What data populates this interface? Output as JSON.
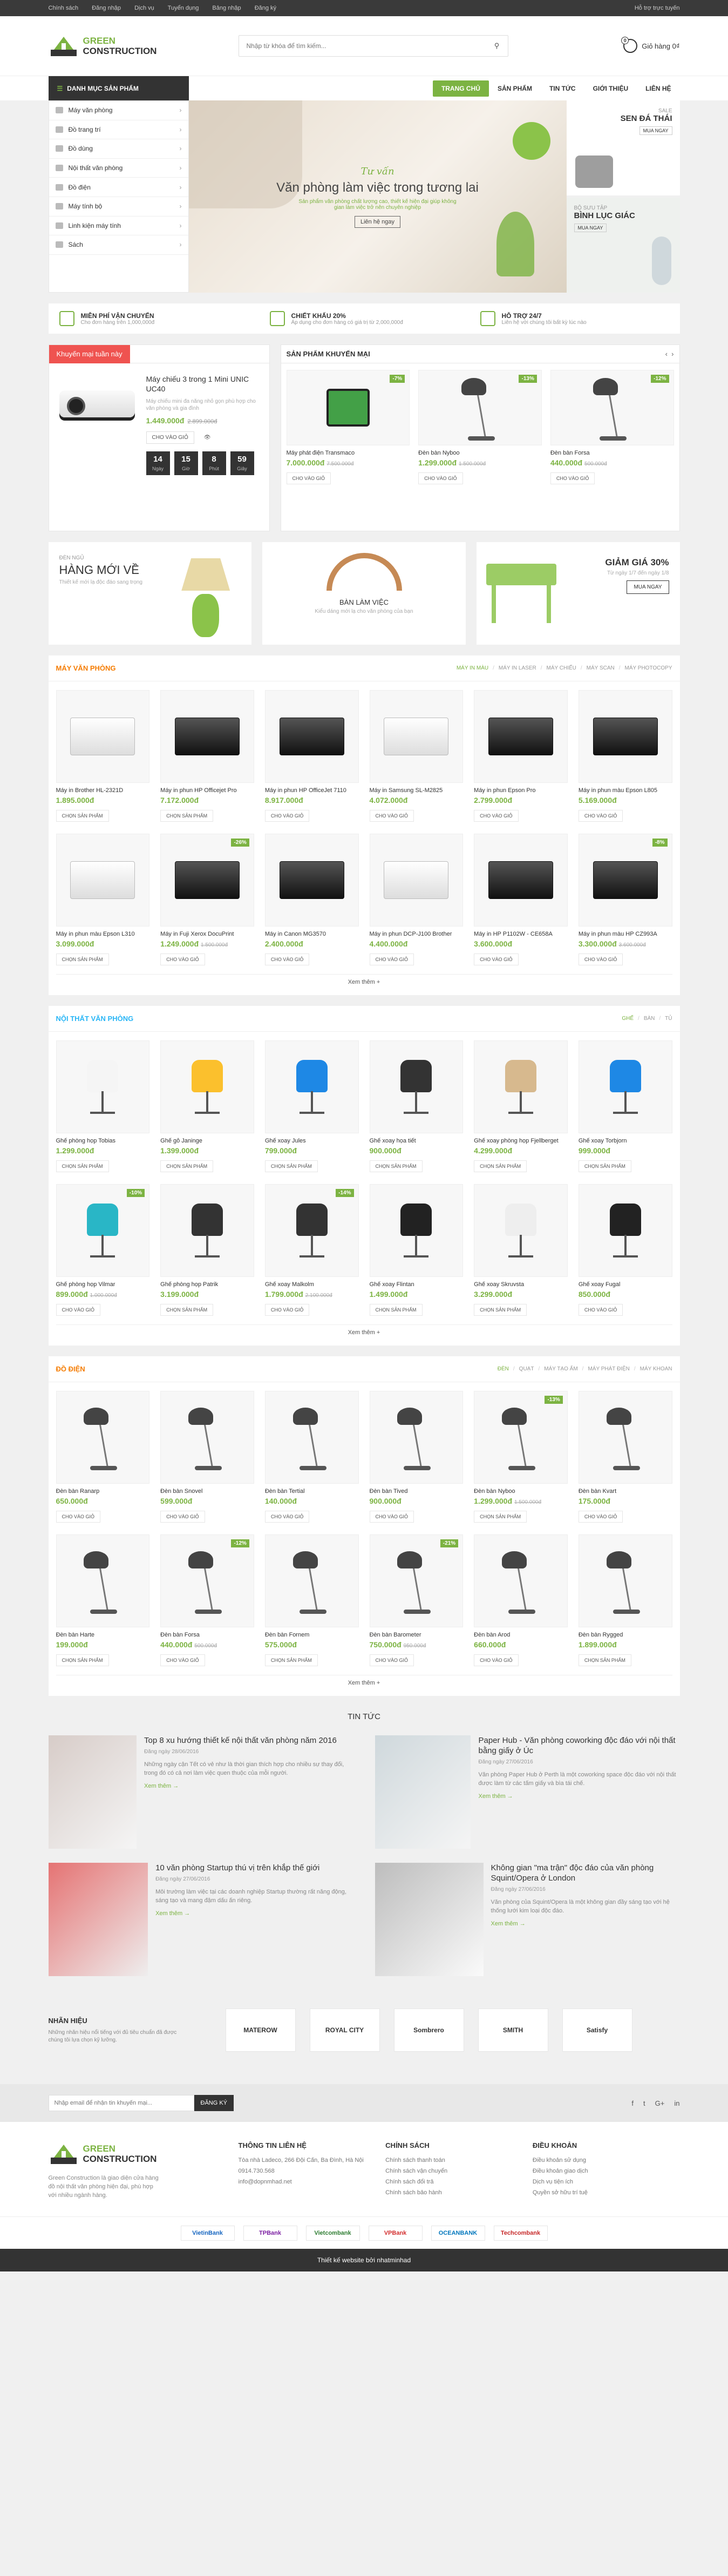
{
  "topbar": {
    "links": [
      "Chính sách",
      "Đăng nhập",
      "Dịch vụ",
      "Tuyển dụng",
      "Bảng nhập",
      "Đăng ký"
    ],
    "right": "Hỗ trợ trực tuyến"
  },
  "header": {
    "brand1": "GREEN",
    "brand2": "CONSTRUCTION",
    "search_placeholder": "Nhập từ khóa để tìm kiếm...",
    "cart_count": "0",
    "cart_label": "Giỏ hàng 0₫"
  },
  "nav": {
    "cat_label": "DANH MỤC SẢN PHẨM",
    "menu": [
      "TRANG CHỦ",
      "SẢN PHẨM",
      "TIN TỨC",
      "GIỚI THIỆU",
      "LIÊN HỆ"
    ]
  },
  "sidebar": [
    "Máy văn phòng",
    "Đồ trang trí",
    "Đồ dùng",
    "Nội thất văn phòng",
    "Đồ điện",
    "Máy tính bộ",
    "Linh kiện máy tính",
    "Sách"
  ],
  "slider": {
    "small": "Tư vấn",
    "big": "Văn phòng làm việc trong tương lai",
    "desc": "Sản phẩm văn phòng chất lượng cao, thiết kế hiện đại giúp không gian làm việc trở nên chuyên nghiệp",
    "btn": "Liên hệ ngay"
  },
  "side_banners": [
    {
      "s": "SALE",
      "t": "SEN ĐÁ THÁI",
      "b": "MUA NGAY"
    },
    {
      "s": "BỘ SƯU TẬP",
      "t": "BÌNH LỤC GIÁC",
      "b": "MUA NGAY"
    }
  ],
  "policy": [
    {
      "t": "MIỄN PHÍ VẬN CHUYỂN",
      "d": "Cho đơn hàng trên 1,000,000đ"
    },
    {
      "t": "CHIẾT KHẤU 20%",
      "d": "Áp dụng cho đơn hàng có giá trị từ 2,000,000đ"
    },
    {
      "t": "HỖ TRỢ 24/7",
      "d": "Liên hệ với chúng tôi bất kỳ lúc nào"
    }
  ],
  "deal": {
    "title": "Khuyến mại tuần này",
    "name": "Máy chiếu 3 trong 1 Mini UNIC UC40",
    "desc": "Máy chiếu mini đa năng nhỏ gọn phù hợp cho văn phòng và gia đình",
    "price": "1.449.000đ",
    "old": "2.899.000đ",
    "cart": "CHO VÀO GIỎ",
    "timer": [
      {
        "v": "14",
        "l": "Ngày"
      },
      {
        "v": "15",
        "l": "Giờ"
      },
      {
        "v": "8",
        "l": "Phút"
      },
      {
        "v": "59",
        "l": "Giây"
      }
    ]
  },
  "promo": {
    "title": "SẢN PHẨM KHUYẾN MẠI",
    "items": [
      {
        "n": "Máy phát điện Transmaco",
        "p": "7.000.000đ",
        "o": "7.500.000đ",
        "b": "-7%"
      },
      {
        "n": "Đèn bàn Nyboo",
        "p": "1.299.000đ",
        "o": "1.500.000đ",
        "b": "-13%"
      },
      {
        "n": "Đèn bàn Forsa",
        "p": "440.000đ",
        "o": "500.000đ",
        "b": "-12%"
      }
    ],
    "cart": "CHO VÀO GIỎ"
  },
  "three": [
    {
      "s": "ĐÈN NGỦ",
      "t": "HÀNG MỚI VỀ",
      "d": "Thiết kế mới lạ độc đáo sang trọng"
    },
    {
      "t": "BÀN LÀM VIỆC",
      "d": "Kiểu dáng mới lạ cho văn phòng của bạn"
    },
    {
      "t": "GIẢM GIÁ 30%",
      "d": "Từ ngày 1/7 đến ngày 1/8",
      "b": "MUA NGAY"
    }
  ],
  "sec_may": {
    "title": "MÁY VĂN PHÒNG",
    "tabs": [
      "MÁY IN MÀU",
      "MÁY IN LASER",
      "MÁY CHIẾU",
      "MÁY SCAN",
      "MÁY PHOTOCOPY"
    ],
    "btn": "CHỌN SẢN PHẨM",
    "cart": "CHO VÀO GIỎ",
    "more": "Xem thêm +",
    "items": [
      {
        "n": "Máy in Brother HL-2321D",
        "p": "1.895.000đ",
        "o": "",
        "b": ""
      },
      {
        "n": "Máy in phun HP Officejet Pro",
        "p": "7.172.000đ",
        "o": "",
        "b": ""
      },
      {
        "n": "Máy in phun HP OfficeJet 7110",
        "p": "8.917.000đ",
        "o": "",
        "b": ""
      },
      {
        "n": "Máy in Samsung SL-M2825",
        "p": "4.072.000đ",
        "o": "",
        "b": ""
      },
      {
        "n": "Máy in phun Epson Pro",
        "p": "2.799.000đ",
        "o": "",
        "b": ""
      },
      {
        "n": "Máy in phun màu Epson L805",
        "p": "5.169.000đ",
        "o": "",
        "b": ""
      },
      {
        "n": "Máy in phun màu Epson L310",
        "p": "3.099.000đ",
        "o": "",
        "b": ""
      },
      {
        "n": "Máy in Fuji Xerox DocuPrint",
        "p": "1.249.000đ",
        "o": "1.500.000đ",
        "b": "-26%"
      },
      {
        "n": "Máy in Canon MG3570",
        "p": "2.400.000đ",
        "o": "",
        "b": ""
      },
      {
        "n": "Máy in phun DCP-J100 Brother",
        "p": "4.400.000đ",
        "o": "",
        "b": ""
      },
      {
        "n": "Máy in HP P1102W - CE658A",
        "p": "3.600.000đ",
        "o": "",
        "b": ""
      },
      {
        "n": "Máy in phun màu HP CZ993A",
        "p": "3.300.000đ",
        "o": "3.600.000đ",
        "b": "-8%"
      }
    ]
  },
  "sec_noi": {
    "title": "NỘI THẤT VĂN PHÒNG",
    "tabs": [
      "GHẾ",
      "BÀN",
      "TỦ"
    ],
    "btn": "CHỌN SẢN PHẨM",
    "cart": "CHO VÀO GIỎ",
    "more": "Xem thêm +",
    "items": [
      {
        "n": "Ghế phòng họp Tobias",
        "p": "1.299.000đ",
        "o": "",
        "b": "",
        "c": "#f5f5f5"
      },
      {
        "n": "Ghế gỗ Janinge",
        "p": "1.399.000đ",
        "o": "",
        "b": "",
        "c": "#fbc02d"
      },
      {
        "n": "Ghế xoay Jules",
        "p": "799.000đ",
        "o": "",
        "b": "",
        "c": "#1e88e5"
      },
      {
        "n": "Ghế xoay họa tiết",
        "p": "900.000đ",
        "o": "",
        "b": "",
        "c": "#333"
      },
      {
        "n": "Ghế xoay phòng họp Fjellberget",
        "p": "4.299.000đ",
        "o": "",
        "b": "",
        "c": "#d7b98e"
      },
      {
        "n": "Ghế xoay Torbjorn",
        "p": "999.000đ",
        "o": "",
        "b": "",
        "c": "#1e88e5"
      },
      {
        "n": "Ghế phòng họp Vilmar",
        "p": "899.000đ",
        "o": "1.000.000đ",
        "b": "-10%",
        "c": "#29b6c6"
      },
      {
        "n": "Ghế phòng họp Patrik",
        "p": "3.199.000đ",
        "o": "",
        "b": "",
        "c": "#333"
      },
      {
        "n": "Ghế xoay Malkolm",
        "p": "1.799.000đ",
        "o": "2.100.000đ",
        "b": "-14%",
        "c": "#333"
      },
      {
        "n": "Ghế xoay Flintan",
        "p": "1.499.000đ",
        "o": "",
        "b": "",
        "c": "#222"
      },
      {
        "n": "Ghế xoay Skruvsta",
        "p": "3.299.000đ",
        "o": "",
        "b": "",
        "c": "#eee"
      },
      {
        "n": "Ghế xoay Fugal",
        "p": "850.000đ",
        "o": "",
        "b": "",
        "c": "#222"
      }
    ]
  },
  "sec_den": {
    "title": "ĐỒ ĐIỆN",
    "tabs": [
      "ĐÈN",
      "QUẠT",
      "MÁY TẠO ẨM",
      "MÁY PHÁT ĐIỆN",
      "MÁY KHOAN"
    ],
    "btn": "CHỌN SẢN PHẨM",
    "cart": "CHO VÀO GIỎ",
    "more": "Xem thêm +",
    "items": [
      {
        "n": "Đèn bàn Ranarp",
        "p": "650.000đ",
        "o": "",
        "b": ""
      },
      {
        "n": "Đèn bàn Snovel",
        "p": "599.000đ",
        "o": "",
        "b": ""
      },
      {
        "n": "Đèn bàn Tertial",
        "p": "140.000đ",
        "o": "",
        "b": ""
      },
      {
        "n": "Đèn bàn Tived",
        "p": "900.000đ",
        "o": "",
        "b": ""
      },
      {
        "n": "Đèn bàn Nyboo",
        "p": "1.299.000đ",
        "o": "1.500.000đ",
        "b": "-13%"
      },
      {
        "n": "Đèn bàn Kvart",
        "p": "175.000đ",
        "o": "",
        "b": ""
      },
      {
        "n": "Đèn bàn Harte",
        "p": "199.000đ",
        "o": "",
        "b": ""
      },
      {
        "n": "Đèn bàn Forsa",
        "p": "440.000đ",
        "o": "500.000đ",
        "b": "-12%"
      },
      {
        "n": "Đèn bàn Fornem",
        "p": "575.000đ",
        "o": "",
        "b": ""
      },
      {
        "n": "Đèn bàn Barometer",
        "p": "750.000đ",
        "o": "950.000đ",
        "b": "-21%"
      },
      {
        "n": "Đèn bàn Arod",
        "p": "660.000đ",
        "o": "",
        "b": ""
      },
      {
        "n": "Đèn bàn Rygged",
        "p": "1.899.000đ",
        "o": "",
        "b": ""
      }
    ]
  },
  "news": {
    "title": "TIN TỨC",
    "more": "Xem thêm →",
    "items": [
      {
        "t": "Top 8 xu hướng thiết kế nội thất văn phòng năm 2016",
        "d": "Đăng ngày 28/06/2016",
        "x": "Những ngày cận Tết có vẻ như là thời gian thích hợp cho nhiều sự thay đổi, trong đó có cả nơi làm việc quen thuộc của mỗi người."
      },
      {
        "t": "Paper Hub - Văn phòng coworking độc đáo với nội thất bằng giấy ở Úc",
        "d": "Đăng ngày 27/06/2016",
        "x": "Văn phòng Paper Hub ở Perth là một coworking space độc đáo với nội thất được làm từ các tấm giấy và bìa tái chế."
      },
      {
        "t": "10 văn phòng Startup thú vị trên khắp thế giới",
        "d": "Đăng ngày 27/06/2016",
        "x": "Môi trường làm việc tại các doanh nghiệp Startup thường rất năng động, sáng tạo và mang đậm dấu ấn riêng."
      },
      {
        "t": "Không gian \"ma trận\" độc đáo của văn phòng Squint/Opera ở London",
        "d": "Đăng ngày 27/06/2016",
        "x": "Văn phòng của Squint/Opera là một không gian đầy sáng tạo với hệ thống lưới kim loại độc đáo."
      }
    ]
  },
  "brands": {
    "title": "NHÃN HIỆU",
    "desc": "Những nhãn hiệu nổi tiếng với đủ tiêu chuẩn đã được chúng tôi lựa chọn kỹ lưỡng.",
    "logos": [
      "MATEROW",
      "ROYAL CITY",
      "Sombrero",
      "SMITH",
      "Satisfy"
    ]
  },
  "newsletter": {
    "placeholder": "Nhập email để nhận tin khuyến mại...",
    "btn": "ĐĂNG KÝ",
    "social": [
      "f",
      "t",
      "G+",
      "in"
    ]
  },
  "footer": {
    "about": "Green Construction là giao diện cửa hàng đồ nội thất văn phòng hiện đại, phù hợp với nhiều ngành hàng.",
    "cols": [
      {
        "h": "THÔNG TIN LIÊN HỆ",
        "li": [
          "Tòa nhà Ladeco, 266 Đội Cấn, Ba Đình, Hà Nội",
          "0914.730.568",
          "info@dopnmhad.net"
        ]
      },
      {
        "h": "CHÍNH SÁCH",
        "li": [
          "Chính sách thanh toán",
          "Chính sách vận chuyển",
          "Chính sách đổi trả",
          "Chính sách bảo hành"
        ]
      },
      {
        "h": "ĐIỀU KHOẢN",
        "li": [
          "Điều khoản sử dụng",
          "Điều khoản giao dịch",
          "Dịch vụ tiện ích",
          "Quyền sở hữu trí tuệ"
        ]
      }
    ]
  },
  "banks": [
    "VietinBank",
    "TPBank",
    "Vietcombank",
    "VPBank",
    "OCEANBANK",
    "Techcombank"
  ],
  "copyright": "Thiết kế website bởi nhatminhad"
}
